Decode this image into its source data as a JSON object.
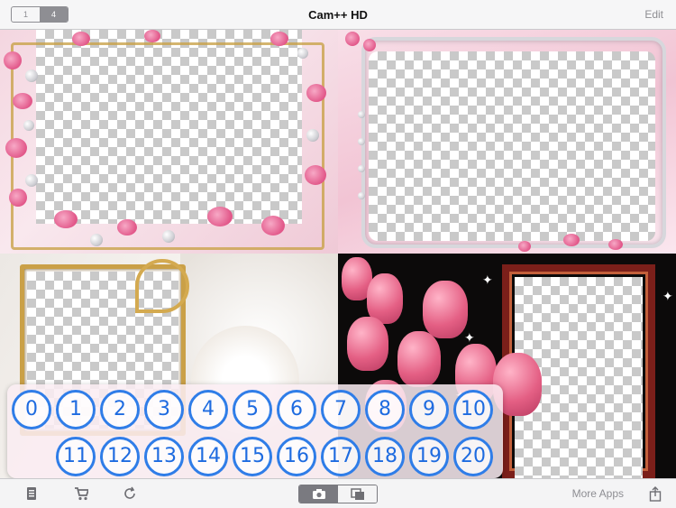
{
  "topbar": {
    "segments": [
      "1",
      "4"
    ],
    "active_segment": "4",
    "title": "Cam++ HD",
    "edit_label": "Edit"
  },
  "frames": [
    {
      "name": "pink-orchid-pearl-frame"
    },
    {
      "name": "pink-ribbon-silver-frame"
    },
    {
      "name": "gold-lace-frame"
    },
    {
      "name": "pink-tulip-wood-frame"
    }
  ],
  "popover": {
    "row1": [
      "0",
      "1",
      "2",
      "3",
      "4",
      "5",
      "6",
      "7",
      "8",
      "9",
      "10"
    ],
    "row2": [
      "11",
      "12",
      "13",
      "14",
      "15",
      "16",
      "17",
      "18",
      "19",
      "20"
    ]
  },
  "bottombar": {
    "icons": [
      "document-icon",
      "cart-icon",
      "refresh-icon",
      "camera-icon",
      "gallery-icon",
      "share-icon"
    ],
    "more_apps_label": "More Apps"
  },
  "colors": {
    "accent_blue": "#2f7de8",
    "toolbar_gray": "#8e8e93"
  }
}
